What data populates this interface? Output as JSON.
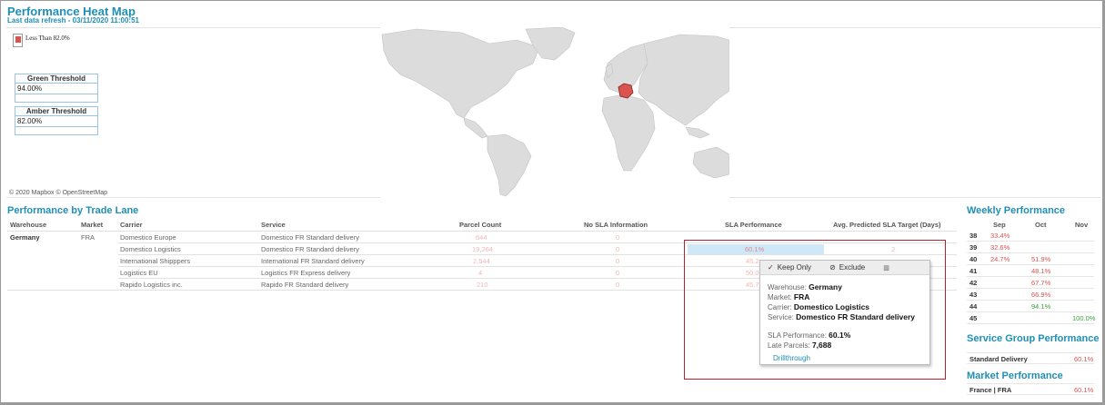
{
  "header": {
    "title": "Performance Heat Map",
    "refresh": "Last data refresh - 03/11/2020 11:00:51"
  },
  "map": {
    "legend": "Less Than 82.0%",
    "green_threshold_label": "Green Threshold",
    "green_threshold_value": "94.00%",
    "amber_threshold_label": "Amber Threshold",
    "amber_threshold_value": "82.00%",
    "attribution": "© 2020 Mapbox  © OpenStreetMap",
    "highlight_color": "#d9534f"
  },
  "trade_lane": {
    "title": "Performance by Trade Lane",
    "columns": [
      "Warehouse",
      "Market",
      "Carrier",
      "Service",
      "Parcel Count",
      "No SLA Information",
      "SLA Performance",
      "Avg. Predicted SLA Target (Days)"
    ],
    "warehouse": "Germany",
    "market": "FRA",
    "rows": [
      {
        "carrier": "Domestico Europe",
        "service": "Domestico FR Standard delivery",
        "parcel_count": "644",
        "no_sla": "0",
        "sla": "",
        "avg": ""
      },
      {
        "carrier": "Domestico Logistics",
        "service": "Domestico FR Standard delivery",
        "parcel_count": "19,264",
        "no_sla": "0",
        "sla": "60.1%",
        "avg": "2"
      },
      {
        "carrier": "International Shipppers",
        "service": "International FR Standard delivery",
        "parcel_count": "2,544",
        "no_sla": "0",
        "sla": "45.2",
        "avg": ""
      },
      {
        "carrier": "Logistics EU",
        "service": "Logistics FR Express delivery",
        "parcel_count": "4",
        "no_sla": "0",
        "sla": "50.0",
        "avg": ""
      },
      {
        "carrier": "Rapido Logistics inc.",
        "service": "Rapido FR Standard delivery",
        "parcel_count": "210",
        "no_sla": "0",
        "sla": "45.7",
        "avg": ""
      }
    ]
  },
  "tooltip": {
    "keep_only": "Keep Only",
    "exclude": "Exclude",
    "warehouse_label": "Warehouse:",
    "warehouse_value": "Germany",
    "market_label": "Market:",
    "market_value": "FRA",
    "carrier_label": "Carrier:",
    "carrier_value": "Domestico Logistics",
    "service_label": "Service:",
    "service_value": "Domestico FR Standard delivery",
    "sla_label": "SLA Performance:",
    "sla_value": "60.1%",
    "late_label": "Late Parcels:",
    "late_value": "7,688",
    "drill": "Drillthrough"
  },
  "weekly": {
    "title": "Weekly Performance",
    "months": [
      "Sep",
      "Oct",
      "Nov"
    ],
    "rows": [
      {
        "week": "38",
        "sep": "33.4%",
        "oct": "",
        "nov": ""
      },
      {
        "week": "39",
        "sep": "32.6%",
        "oct": "",
        "nov": ""
      },
      {
        "week": "40",
        "sep": "24.7%",
        "oct": "51.9%",
        "nov": ""
      },
      {
        "week": "41",
        "sep": "",
        "oct": "48.1%",
        "nov": ""
      },
      {
        "week": "42",
        "sep": "",
        "oct": "67.7%",
        "nov": ""
      },
      {
        "week": "43",
        "sep": "",
        "oct": "66.9%",
        "nov": ""
      },
      {
        "week": "44",
        "sep": "",
        "oct": "94.1%",
        "nov": ""
      },
      {
        "week": "45",
        "sep": "",
        "oct": "",
        "nov": "100.0%"
      }
    ]
  },
  "service_group": {
    "title": "Service Group Performance",
    "label": "Standard Delivery",
    "value": "60.1%"
  },
  "market_perf": {
    "title": "Market Performance",
    "label": "France | FRA",
    "value": "60.1%"
  }
}
